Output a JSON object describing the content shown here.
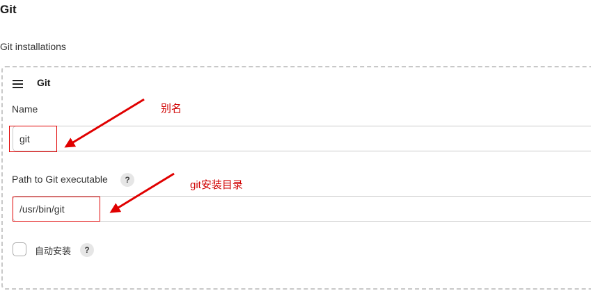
{
  "section": {
    "title": "Git",
    "installations_label": "Git installations"
  },
  "git_block": {
    "title": "Git",
    "name_label": "Name",
    "name_value": "git",
    "path_label": "Path to Git executable",
    "path_value": "/usr/bin/git",
    "auto_install_label": "自动安装",
    "help_glyph": "?"
  },
  "annotations": {
    "alias_note": "别名",
    "install_dir_note": "git安装目录",
    "color": "#e00000"
  }
}
